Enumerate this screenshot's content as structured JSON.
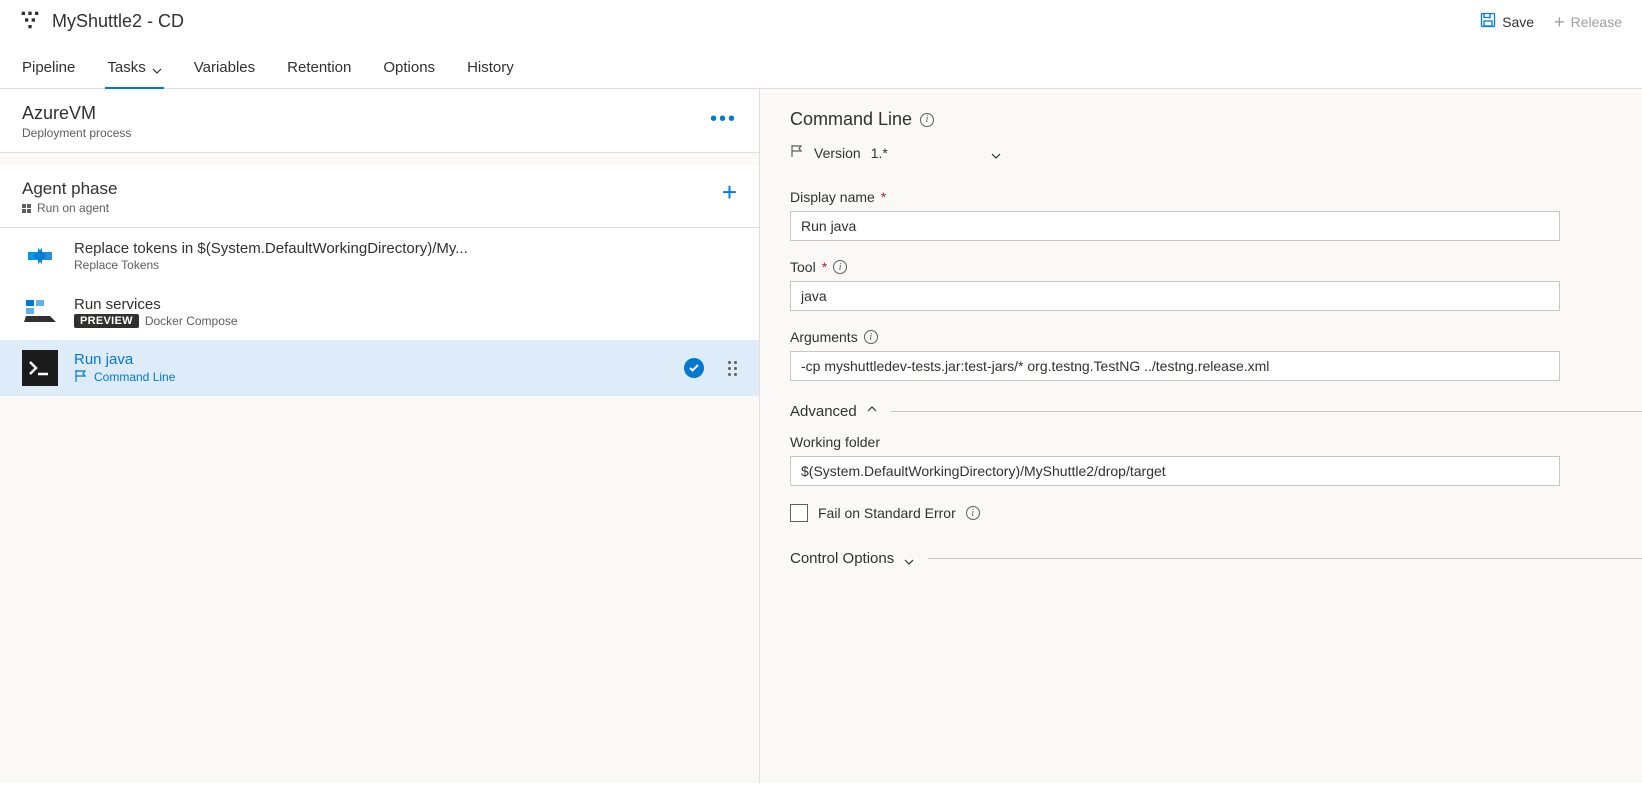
{
  "header": {
    "title": "MyShuttle2 - CD",
    "save_label": "Save",
    "release_label": "Release"
  },
  "tabs": {
    "items": [
      {
        "label": "Pipeline"
      },
      {
        "label": "Tasks"
      },
      {
        "label": "Variables"
      },
      {
        "label": "Retention"
      },
      {
        "label": "Options"
      },
      {
        "label": "History"
      }
    ]
  },
  "process": {
    "title": "AzureVM",
    "sub": "Deployment process"
  },
  "phase": {
    "title": "Agent phase",
    "sub": "Run on agent"
  },
  "tasks": [
    {
      "title": "Replace tokens in $(System.DefaultWorkingDirectory)/My...",
      "sub": "Replace Tokens"
    },
    {
      "title": "Run services",
      "badge": "PREVIEW",
      "sub": "Docker Compose"
    },
    {
      "title": "Run java",
      "sub": "Command Line"
    }
  ],
  "details": {
    "panel_title": "Command Line",
    "version_label": "Version",
    "version": "1.*",
    "display_name_label": "Display name",
    "display_name": "Run java",
    "tool_label": "Tool",
    "tool": "java",
    "arguments_label": "Arguments",
    "arguments": "-cp myshuttledev-tests.jar:test-jars/* org.testng.TestNG ../testng.release.xml",
    "advanced_label": "Advanced",
    "working_folder_label": "Working folder",
    "working_folder": "$(System.DefaultWorkingDirectory)/MyShuttle2/drop/target",
    "fail_stderr_label": "Fail on Standard Error",
    "control_options_label": "Control Options"
  }
}
